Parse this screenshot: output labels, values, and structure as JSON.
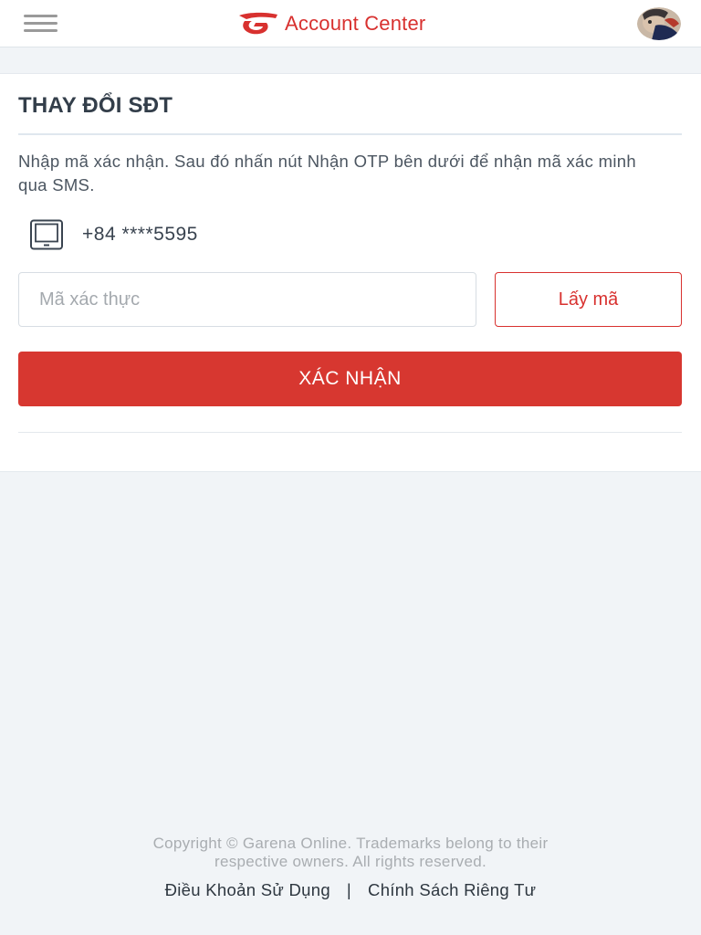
{
  "header": {
    "title": "Account Center",
    "accent_color": "#d8312f",
    "menu_icon": "hamburger-menu-icon",
    "logo_icon": "garena-logo-icon",
    "avatar": "user-avatar"
  },
  "form": {
    "title": "THAY ĐỔI SĐT",
    "instruction": "Nhập mã xác nhận. Sau đó nhấn nút Nhận OTP bên dưới để nhận mã xác minh qua SMS.",
    "phone_icon": "tablet-icon",
    "phone_number": "+84 ****5595",
    "code_input": {
      "value": "",
      "placeholder": "Mã xác thực"
    },
    "get_code_label": "Lấy mã",
    "confirm_label": "XÁC NHẬN",
    "confirm_color": "#d73730"
  },
  "footer": {
    "copyright_line1": "Copyright © Garena Online. Trademarks belong to their",
    "copyright_line2": "respective owners. All rights reserved.",
    "terms_label": "Điều Khoản Sử Dụng",
    "separator": "|",
    "privacy_label": "Chính Sách Riêng Tư"
  }
}
